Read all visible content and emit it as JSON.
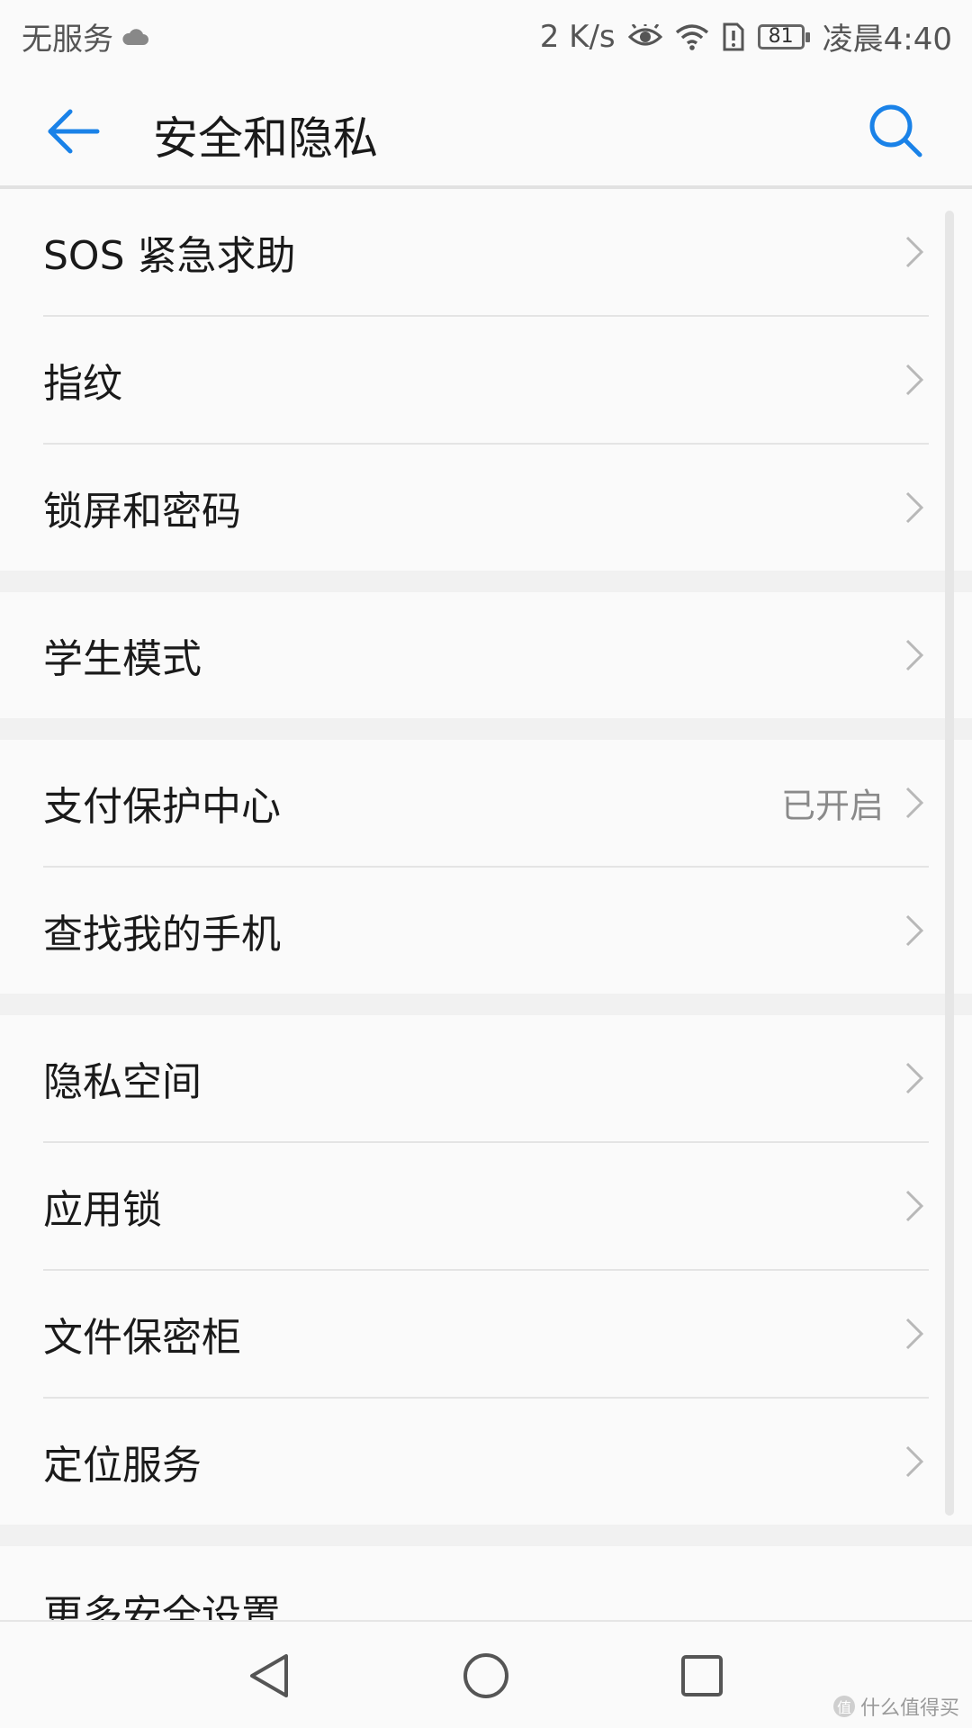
{
  "status_bar": {
    "carrier": "无服务",
    "speed": "2 K/s",
    "battery": "81",
    "time": "凌晨4:40"
  },
  "header": {
    "title": "安全和隐私"
  },
  "groups": [
    {
      "items": [
        {
          "label": "SOS 紧急求助"
        },
        {
          "label": "指纹"
        },
        {
          "label": "锁屏和密码"
        }
      ]
    },
    {
      "items": [
        {
          "label": "学生模式"
        }
      ]
    },
    {
      "items": [
        {
          "label": "支付保护中心",
          "value": "已开启"
        },
        {
          "label": "查找我的手机"
        }
      ]
    },
    {
      "items": [
        {
          "label": "隐私空间"
        },
        {
          "label": "应用锁"
        },
        {
          "label": "文件保密柜"
        },
        {
          "label": "定位服务"
        }
      ]
    },
    {
      "items": [
        {
          "label": "更多安全设置"
        }
      ]
    }
  ],
  "watermark": "什么值得买",
  "colors": {
    "accent": "#1a82e8",
    "background": "#f1f1f1",
    "card": "#fafafa"
  }
}
